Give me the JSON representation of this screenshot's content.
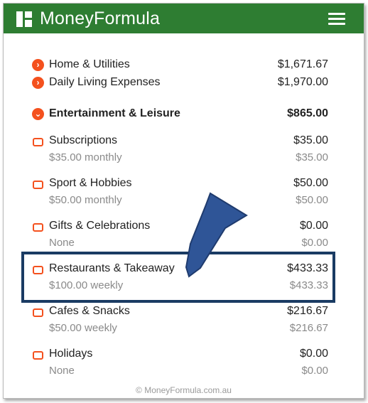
{
  "app": {
    "title": "MoneyFormula"
  },
  "items": [
    {
      "name": "Home & Utilities",
      "amount": "$1,671.67"
    },
    {
      "name": "Daily Living Expenses",
      "amount": "$1,970.00"
    },
    {
      "name": "Entertainment & Leisure",
      "amount": "$865.00"
    },
    {
      "name": "Subscriptions",
      "amount": "$35.00",
      "detail": "$35.00 monthly",
      "detail_amount": "$35.00"
    },
    {
      "name": "Sport & Hobbies",
      "amount": "$50.00",
      "detail": "$50.00 monthly",
      "detail_amount": "$50.00"
    },
    {
      "name": "Gifts & Celebrations",
      "amount": "$0.00",
      "detail": "None",
      "detail_amount": "$0.00"
    },
    {
      "name": "Restaurants & Takeaway",
      "amount": "$433.33",
      "detail": "$100.00 weekly",
      "detail_amount": "$433.33"
    },
    {
      "name": "Cafes & Snacks",
      "amount": "$216.67",
      "detail": "$50.00 weekly",
      "detail_amount": "$216.67"
    },
    {
      "name": "Holidays",
      "amount": "$0.00",
      "detail": "None",
      "detail_amount": "$0.00"
    }
  ],
  "footer": {
    "text": "© MoneyFormula.com.au"
  },
  "colors": {
    "header": "#2e7d32",
    "accent": "#f4511e",
    "annotation": "#1a3b63",
    "arrow": "#2f5597"
  }
}
